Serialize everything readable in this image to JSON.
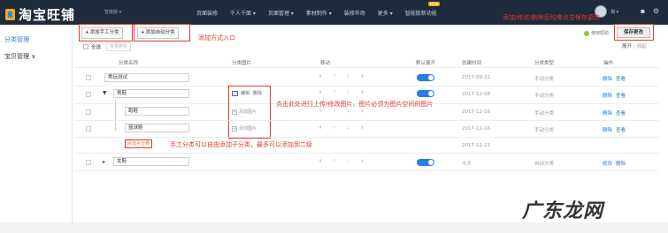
{
  "topbar": {
    "brand": "淘宝旺铺",
    "shop_selector": "智能版 ▾",
    "nav": [
      "页面装修",
      "千人千面 ▾",
      "页面管理 ▾",
      "素材制作 ▾",
      "装修市场",
      "更多 ▾",
      "智能版新功能"
    ],
    "nav_badge": "NEW",
    "user": "淘 ▾",
    "icons": [
      "message-icon",
      "settings-icon"
    ]
  },
  "sidebar": {
    "items": [
      {
        "label": "分类管理",
        "active": true
      },
      {
        "label": "宝贝管理 ∨",
        "active": false
      }
    ]
  },
  "toolbar": {
    "add_manual": "添加手工分类",
    "add_auto": "添加自动分类",
    "help": "使用帮助",
    "save": "保存更改",
    "expand": "展开",
    "collapse": "收起",
    "select_all": "全选",
    "batch_delete": "批量删除"
  },
  "annotations": {
    "add_entry": "添加方式入口",
    "save_note": "添加/修改/删除后均需点击保存更改",
    "image_note": "点击此处进行上传/修改图片，图片必须为图片空间的图片",
    "subcat_note": "手工分类可以自由添加子分类，最多可以添加到二级"
  },
  "table": {
    "headers": [
      "分类名称",
      "分类图片",
      "移动",
      "默认展开",
      "创建时间",
      "分类类型",
      "操作"
    ],
    "rows": [
      {
        "name": "秀玩测试",
        "image": "none",
        "expand": true,
        "created": "2017-09-22",
        "type": "手动分类",
        "ops": [
          "删除",
          "查看"
        ]
      },
      {
        "name": "男鞋",
        "image": "set",
        "expand": true,
        "created": "2017-12-08",
        "type": "手动分类",
        "ops": [
          "删除",
          "查看"
        ]
      },
      {
        "name": "跑鞋",
        "image": "add",
        "expand": false,
        "created": "2017-12-16",
        "type": "手动分类",
        "ops": [
          "删除",
          "查看"
        ]
      },
      {
        "name": "篮球鞋",
        "image": "add",
        "expand": false,
        "created": "2017-12-16",
        "type": "手动分类",
        "ops": [
          "删除",
          "查看"
        ]
      },
      {
        "name": "",
        "image": "none",
        "expand": false,
        "created": "2017-12-21",
        "type": "",
        "ops": []
      },
      {
        "name": "女鞋",
        "image": "none",
        "expand": true,
        "created": "今天",
        "type": "自动分类",
        "ops": [
          "修改",
          "删除"
        ]
      }
    ],
    "image_edit": "编辑",
    "image_delete": "删除",
    "image_add": "添加图片",
    "add_subcategory": "添加子分类",
    "move_glyphs": "⇞ ⇡ ⇣ ⇟"
  },
  "watermark": "广东龙网"
}
